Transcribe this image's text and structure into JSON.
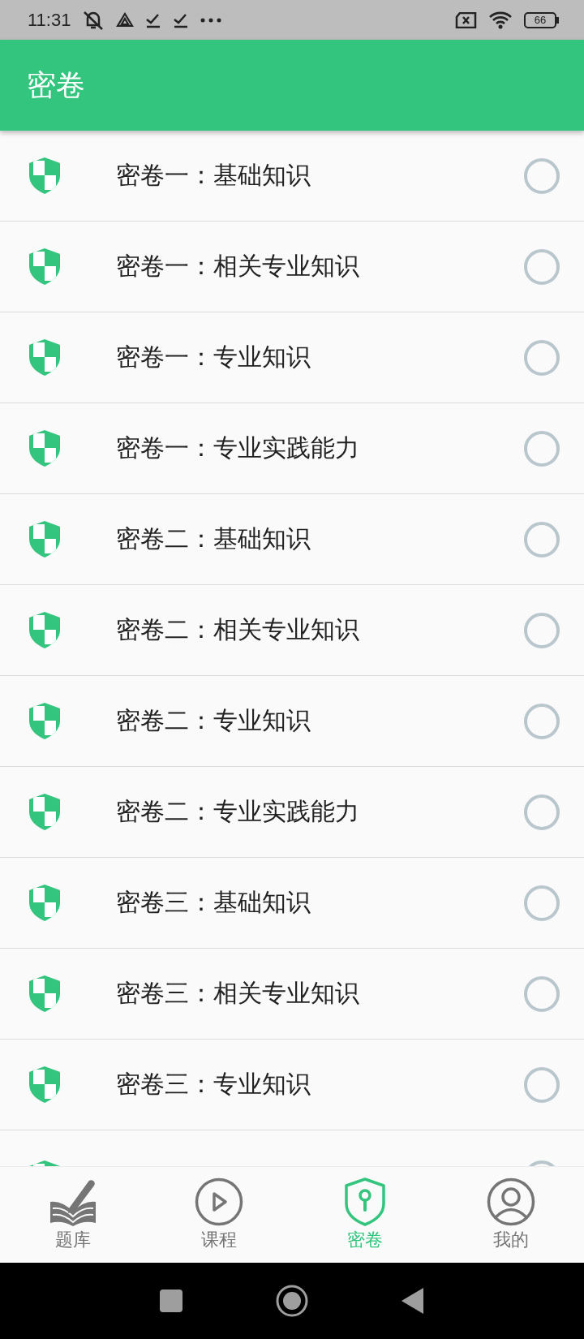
{
  "status_bar": {
    "time": "11:31",
    "battery": "66"
  },
  "app_bar": {
    "title": "密卷"
  },
  "papers": [
    {
      "kind": "row",
      "label": "密卷一：基础知识",
      "completed": false
    },
    {
      "kind": "row",
      "label": "密卷一：相关专业知识",
      "completed": false
    },
    {
      "kind": "row",
      "label": "密卷一：专业知识",
      "completed": false
    },
    {
      "kind": "row",
      "label": "密卷一：专业实践能力",
      "completed": false
    },
    {
      "kind": "row",
      "label": "密卷二：基础知识",
      "completed": false
    },
    {
      "kind": "row",
      "label": "密卷二：相关专业知识",
      "completed": false
    },
    {
      "kind": "row",
      "label": "密卷二：专业知识",
      "completed": false
    },
    {
      "kind": "row",
      "label": "密卷二：专业实践能力",
      "completed": false
    },
    {
      "kind": "row",
      "label": "密卷三：基础知识",
      "completed": false
    },
    {
      "kind": "row",
      "label": "密卷三：相关专业知识",
      "completed": false
    },
    {
      "kind": "row",
      "label": "密卷三：专业知识",
      "completed": false
    },
    {
      "kind": "cut",
      "completed": false
    }
  ],
  "tabs": [
    {
      "label": "题库",
      "selected": false
    },
    {
      "label": "课程",
      "selected": false
    },
    {
      "label": "密卷",
      "selected": true
    },
    {
      "label": "我的",
      "selected": false
    }
  ]
}
